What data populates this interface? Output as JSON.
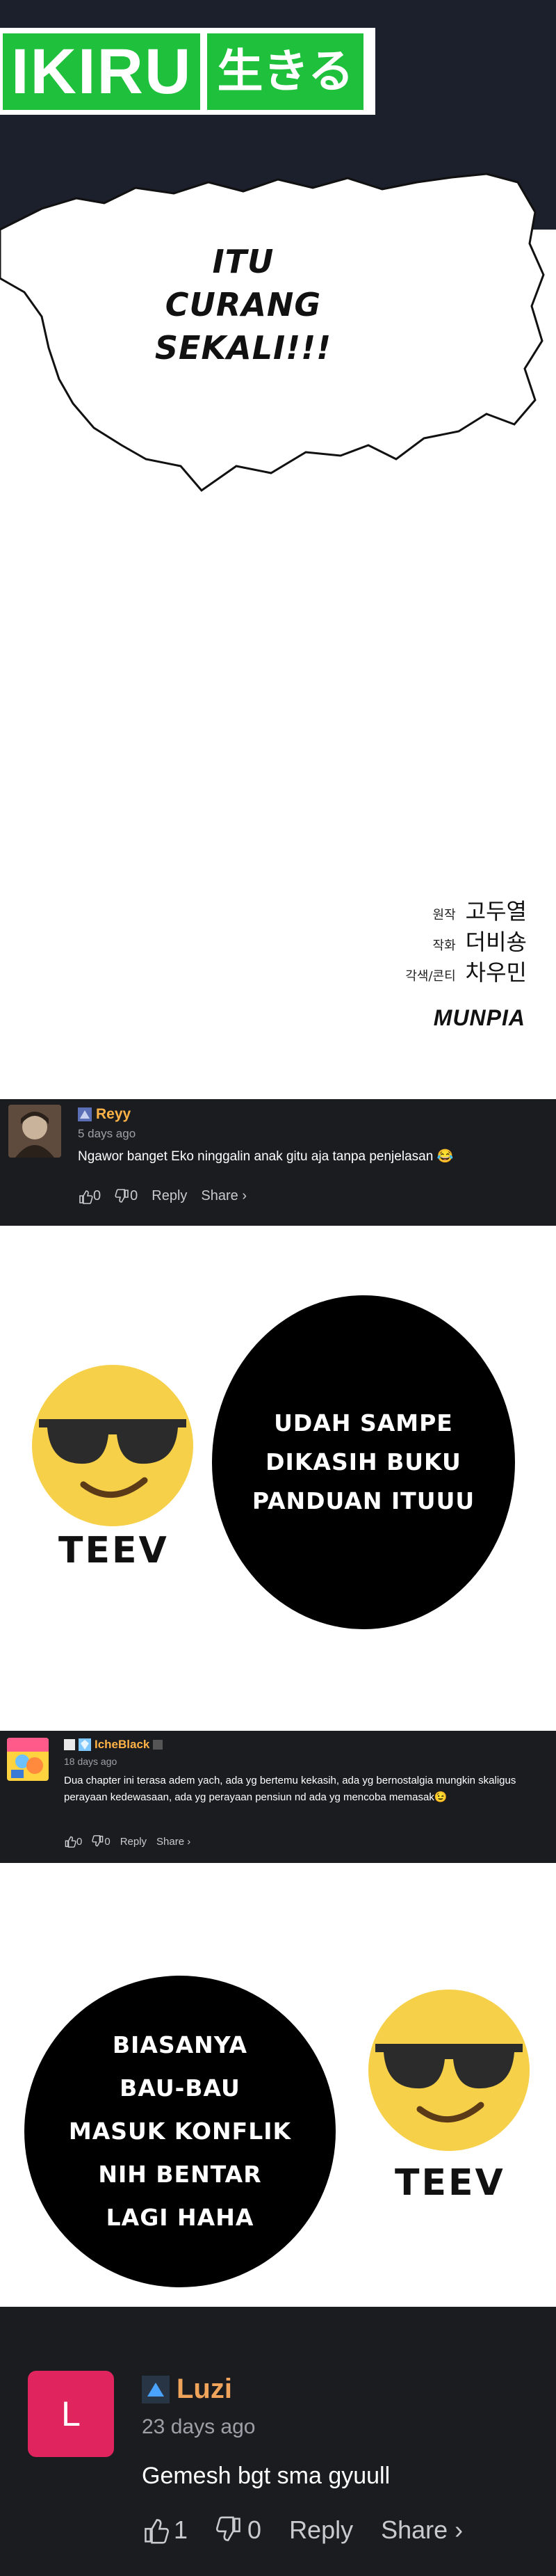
{
  "logo": {
    "text_en": "IKIRU",
    "text_jp": "生きる"
  },
  "speech_bubble": {
    "line1": "ITU",
    "line2": "CURANG SEKALI!!!"
  },
  "credits": [
    {
      "role": "원작",
      "name": "고두열"
    },
    {
      "role": "작화",
      "name": "더비숑"
    },
    {
      "role": "각색/콘티",
      "name": "차우민"
    }
  ],
  "publisher": "MUNPIA",
  "comments": [
    {
      "username": "Reyy",
      "time": "5 days ago",
      "text": "Ngawor banget Eko ninggalin anak gitu aja tanpa penjelasan 😂",
      "likes": "0",
      "dislikes": "0",
      "reply": "Reply",
      "share": "Share ›"
    },
    {
      "username": "IcheBlack",
      "time": "18 days ago",
      "text": "Dua chapter ini terasa adem yach, ada yg bertemu kekasih, ada yg bernostalgia mungkin skaligus perayaan kedewasaan, ada yg perayaan pensiun nd ada yg mencoba memasak😉",
      "likes": "0",
      "dislikes": "0",
      "reply": "Reply",
      "share": "Share ›"
    },
    {
      "username": "Luzi",
      "avatar_letter": "L",
      "time": "23 days ago",
      "text": "Gemesh bgt sma gyuull",
      "likes": "1",
      "dislikes": "0",
      "reply": "Reply",
      "share": "Share ›"
    }
  ],
  "panels": [
    {
      "speech": [
        "UDAH SAMPE",
        "DIKASIH BUKU",
        "PANDUAN ITUUU"
      ],
      "label": "TEEV"
    },
    {
      "speech": [
        "BIASANYA",
        "BAU-BAU",
        "MASUK KONFLIK",
        "NIH BENTAR",
        "LAGI HAHA"
      ],
      "label": "TEEV"
    }
  ],
  "colors": {
    "comment_bg": "#1b1c20",
    "username": "#ffb347",
    "logo_green": "#1ec03c",
    "avatar_luzi": "#e0245e"
  }
}
